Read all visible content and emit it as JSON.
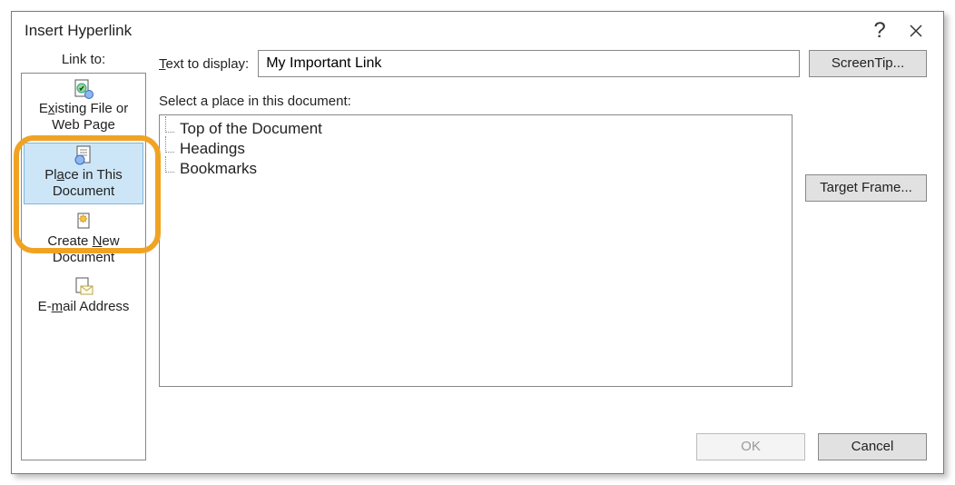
{
  "dialog": {
    "title": "Insert Hyperlink"
  },
  "linkto": {
    "label": "Link to:",
    "items": [
      {
        "icon": "existing-file-icon",
        "line1_pre": "E",
        "line1_key": "x",
        "line1_post": "isting File or",
        "line2": "Web Page"
      },
      {
        "icon": "place-doc-icon",
        "line1_pre": "Pl",
        "line1_key": "a",
        "line1_post": "ce in This",
        "line2": "Document"
      },
      {
        "icon": "new-doc-icon",
        "line1_pre": "Create ",
        "line1_key": "N",
        "line1_post": "ew",
        "line2": "Document"
      },
      {
        "icon": "email-icon",
        "line1_pre": "E-",
        "line1_key": "m",
        "line1_post": "ail Address",
        "line2": ""
      }
    ]
  },
  "display": {
    "label_pre": "",
    "label_key": "T",
    "label_post": "ext to display:",
    "value": "My Important Link"
  },
  "buttons": {
    "screentip": "ScreenTip...",
    "target_frame": "Target Frame...",
    "ok": "OK",
    "cancel": "Cancel"
  },
  "select": {
    "label": "Select a place in this document:",
    "items": [
      "Top of the Document",
      "Headings",
      "Bookmarks"
    ]
  }
}
